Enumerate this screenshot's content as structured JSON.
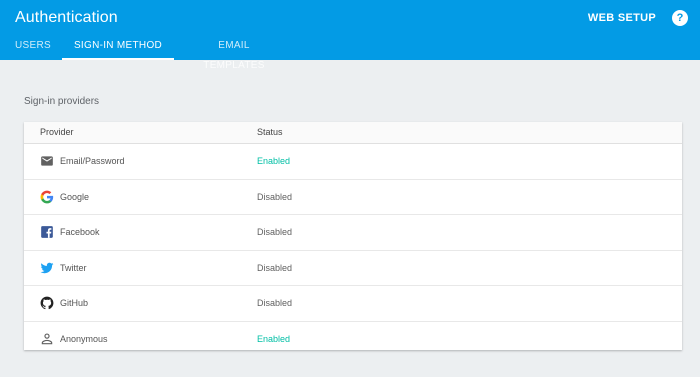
{
  "header": {
    "title": "Authentication",
    "web_setup_label": "WEB SETUP",
    "help_label": "?"
  },
  "tabs": [
    {
      "label": "USERS",
      "active": false
    },
    {
      "label": "SIGN-IN METHOD",
      "active": true
    },
    {
      "label": "EMAIL TEMPLATES",
      "active": false
    }
  ],
  "section": {
    "title": "Sign-in providers"
  },
  "table": {
    "columns": [
      "Provider",
      "Status"
    ],
    "rows": [
      {
        "provider": "Email/Password",
        "status": "Enabled",
        "icon": "mail-icon"
      },
      {
        "provider": "Google",
        "status": "Disabled",
        "icon": "google-icon"
      },
      {
        "provider": "Facebook",
        "status": "Disabled",
        "icon": "facebook-icon"
      },
      {
        "provider": "Twitter",
        "status": "Disabled",
        "icon": "twitter-icon"
      },
      {
        "provider": "GitHub",
        "status": "Disabled",
        "icon": "github-icon"
      },
      {
        "provider": "Anonymous",
        "status": "Enabled",
        "icon": "anonymous-user-icon"
      }
    ]
  },
  "colors": {
    "header_blue": "#039be5",
    "enabled_green": "#00bfa5",
    "page_bg": "#eceff1"
  }
}
